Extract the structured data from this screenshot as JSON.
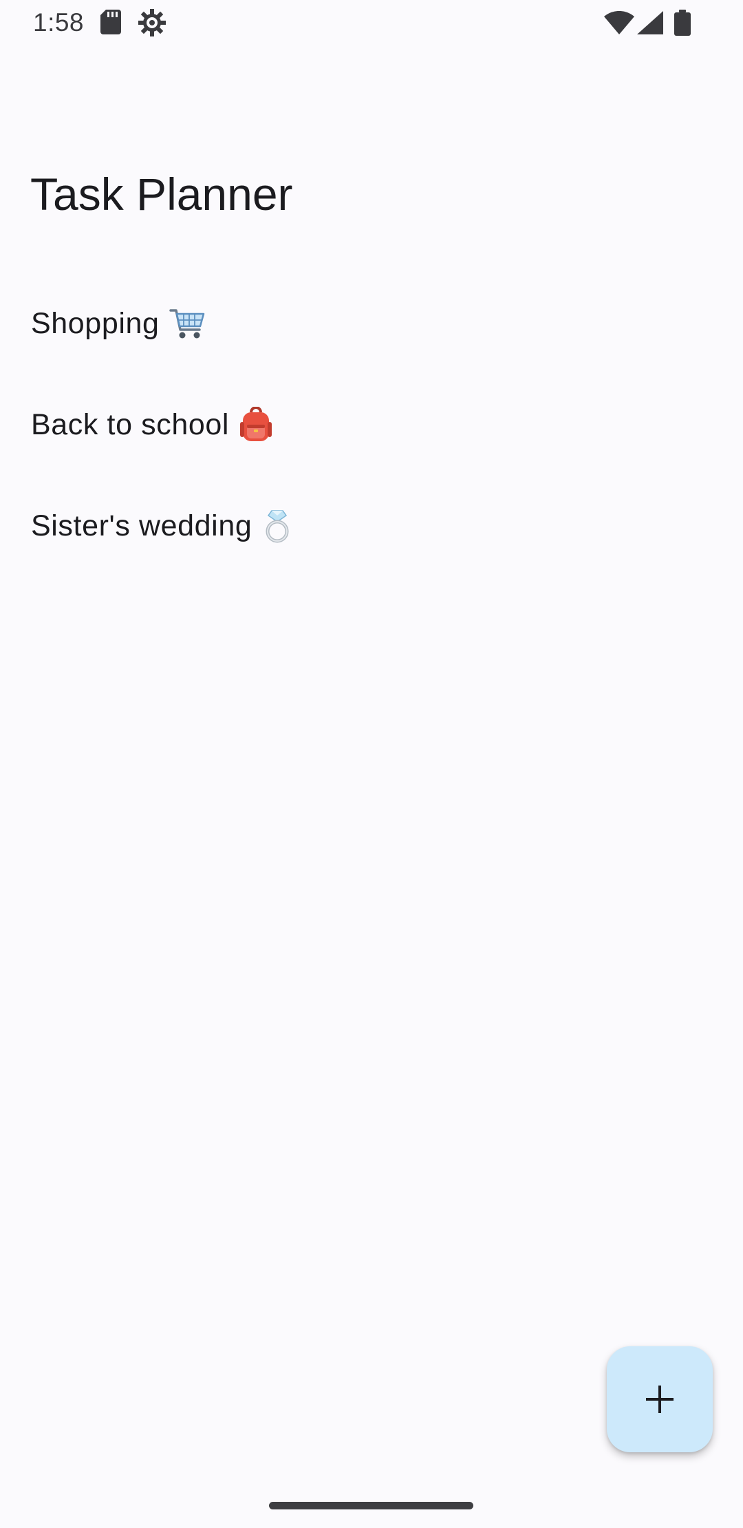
{
  "status_bar": {
    "time": "1:58",
    "icons": [
      "sd-card-icon",
      "settings-icon",
      "wifi-icon",
      "cell-signal-icon",
      "battery-icon"
    ]
  },
  "header": {
    "title": "Task Planner"
  },
  "tasks": [
    {
      "label": "Shopping",
      "emoji": "shopping-cart-icon"
    },
    {
      "label": "Back to school",
      "emoji": "backpack-icon"
    },
    {
      "label": "Sister's wedding",
      "emoji": "ring-icon"
    }
  ],
  "fab": {
    "icon": "plus-icon",
    "color": "#CDE9FB"
  },
  "colors": {
    "background": "#FBFAFD",
    "text": "#1B1B1F",
    "fab": "#CDE9FB"
  }
}
